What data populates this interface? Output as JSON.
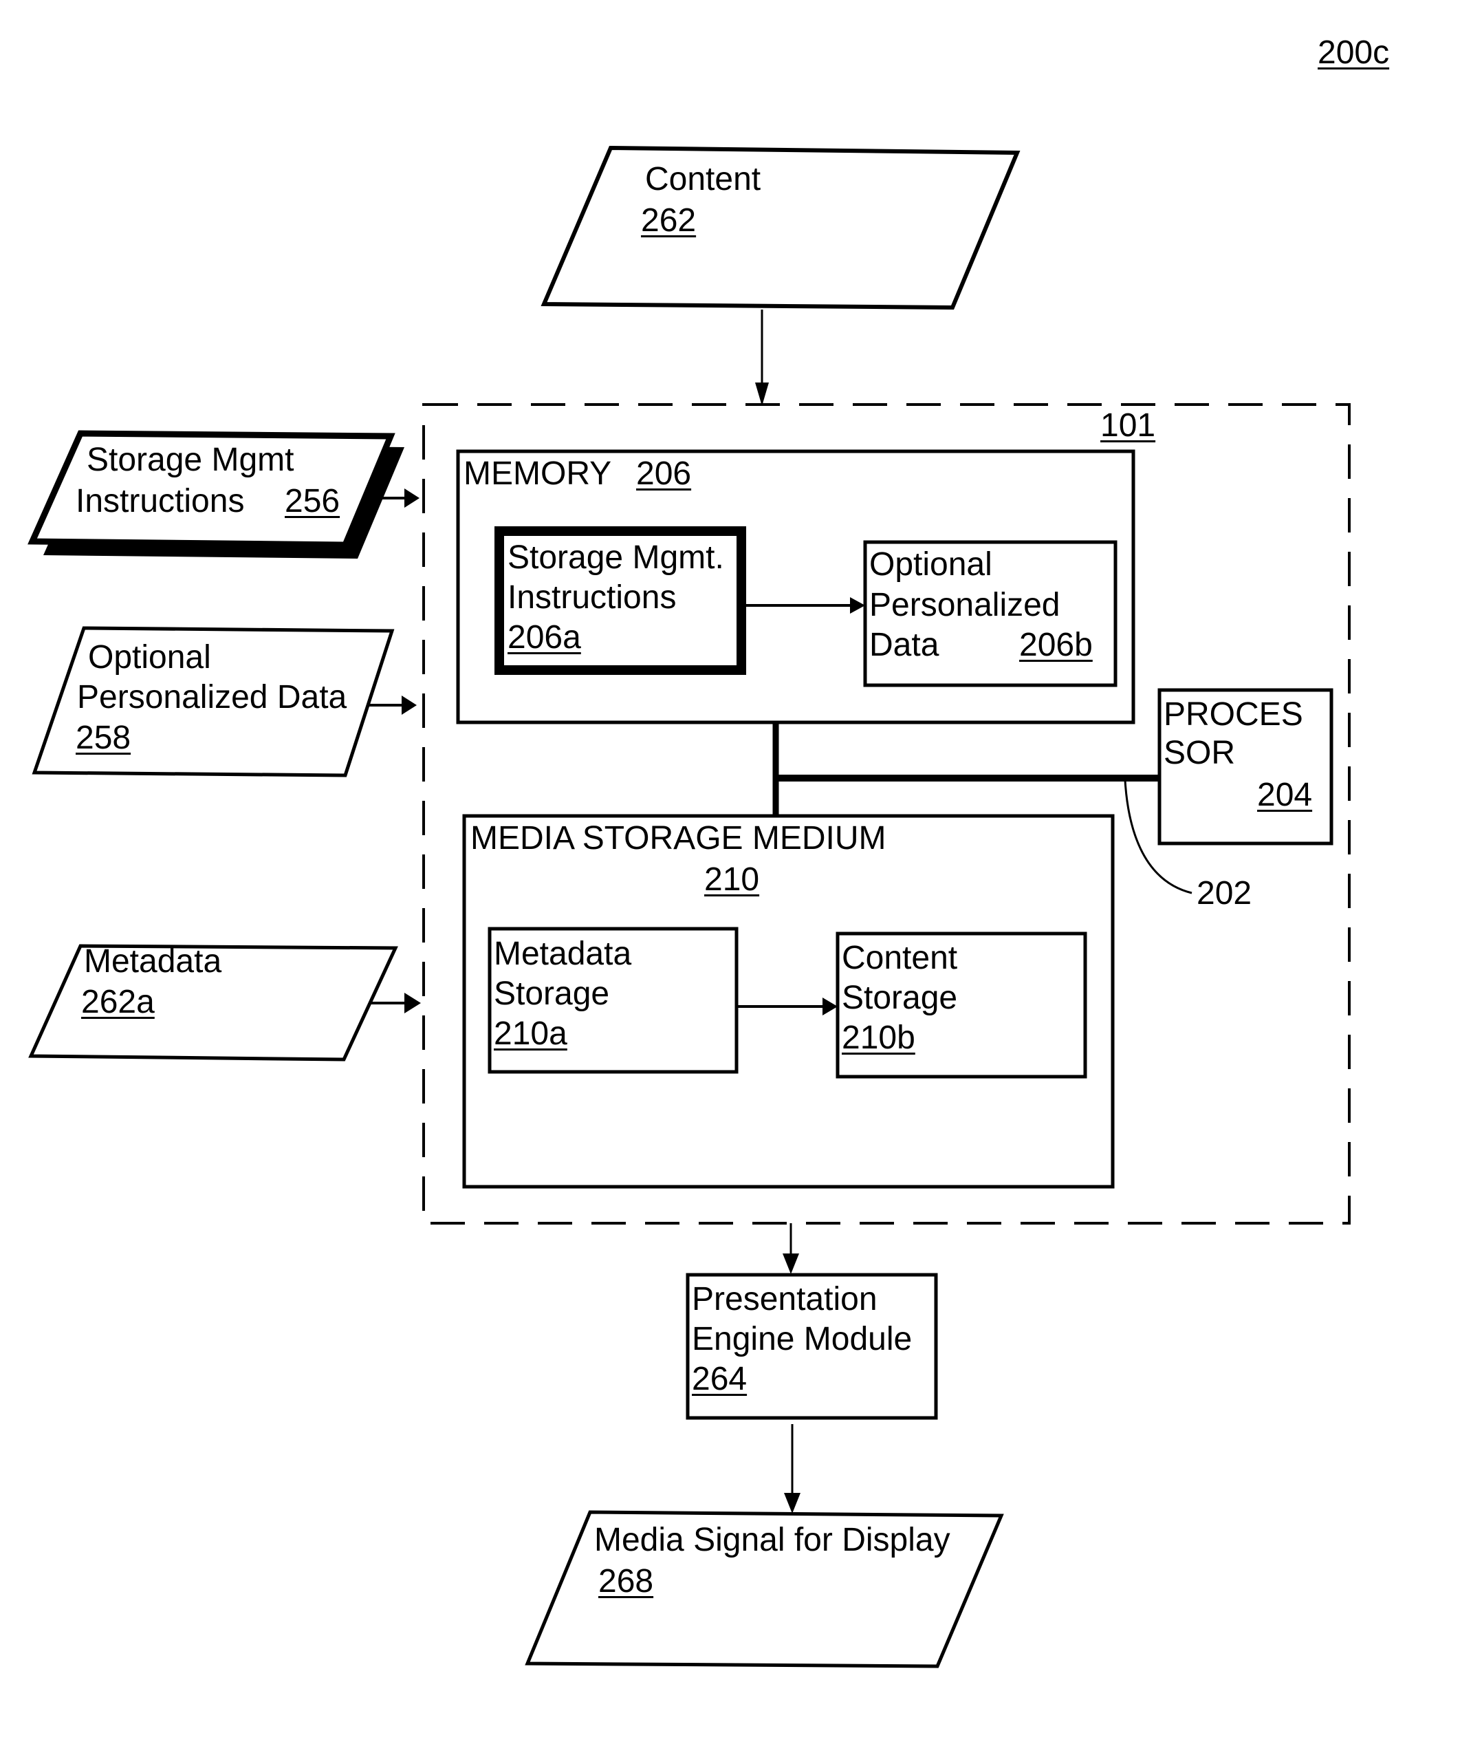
{
  "figure_label": "200c",
  "colors": {
    "line": "#000000",
    "background": "#ffffff"
  },
  "nodes": {
    "content": {
      "title": "Content",
      "ref": "262",
      "shape": "parallelogram"
    },
    "storage_mgmt_instructions_input": {
      "line1": "Storage Mgmt",
      "line2": "Instructions",
      "ref": "256",
      "shape": "parallelogram-shadowed"
    },
    "optional_personalized_data_input": {
      "line1": "Optional",
      "line2": "Personalized Data",
      "ref": "258",
      "shape": "parallelogram"
    },
    "metadata_input": {
      "title": "Metadata",
      "ref": "262a",
      "shape": "parallelogram"
    },
    "device": {
      "ref": "101",
      "shape": "dashed-box"
    },
    "memory": {
      "title": "MEMORY",
      "ref": "206"
    },
    "storage_mgmt_instructions": {
      "line1": "Storage Mgmt.",
      "line2": "Instructions",
      "ref": "206a"
    },
    "optional_personalized_data": {
      "line1": "Optional",
      "line2": "Personalized",
      "line3": "Data",
      "ref": "206b"
    },
    "processor": {
      "line1": "PROCES",
      "line2": "SOR",
      "ref": "204"
    },
    "bus": {
      "ref": "202"
    },
    "media_storage_medium": {
      "title": "MEDIA STORAGE MEDIUM",
      "ref": "210"
    },
    "metadata_storage": {
      "line1": "Metadata",
      "line2": "Storage",
      "ref": "210a"
    },
    "content_storage": {
      "line1": "Content",
      "line2": "Storage",
      "ref": "210b"
    },
    "presentation_engine": {
      "line1": "Presentation",
      "line2": "Engine Module",
      "ref": "264"
    },
    "media_signal": {
      "title": "Media Signal for Display",
      "ref": "268",
      "shape": "parallelogram"
    }
  },
  "edges": [
    {
      "from": "content",
      "to": "device"
    },
    {
      "from": "storage_mgmt_instructions_input",
      "to": "device"
    },
    {
      "from": "optional_personalized_data_input",
      "to": "device"
    },
    {
      "from": "metadata_input",
      "to": "device"
    },
    {
      "from": "storage_mgmt_instructions",
      "to": "optional_personalized_data"
    },
    {
      "from": "metadata_storage",
      "to": "content_storage"
    },
    {
      "from": "memory",
      "to": "bus"
    },
    {
      "from": "media_storage_medium",
      "to": "bus"
    },
    {
      "from": "processor",
      "to": "bus"
    },
    {
      "from": "device",
      "to": "presentation_engine"
    },
    {
      "from": "presentation_engine",
      "to": "media_signal"
    }
  ]
}
